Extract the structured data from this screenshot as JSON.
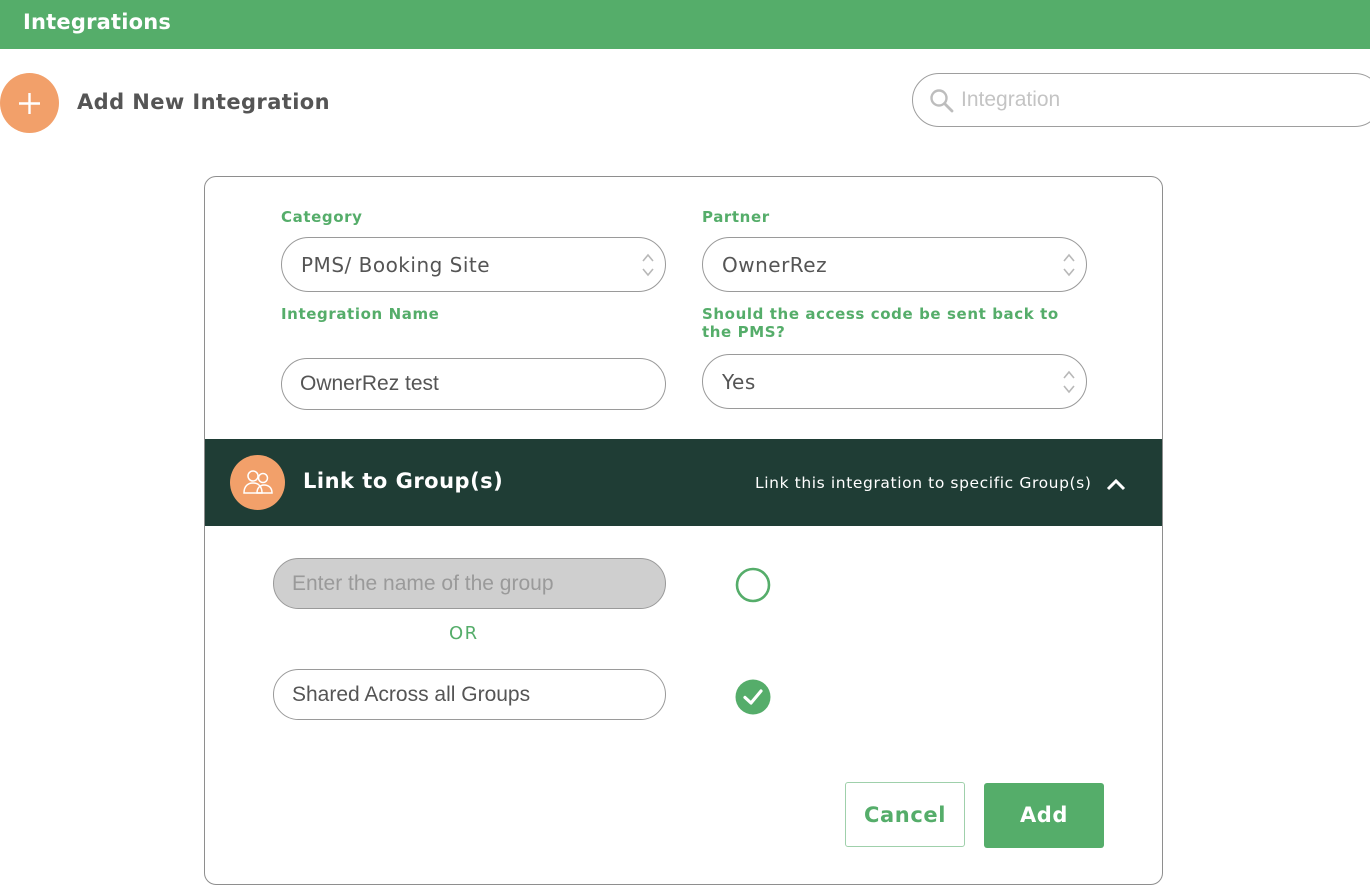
{
  "header": {
    "title": "Integrations"
  },
  "toolbar": {
    "add_label": "Add New Integration"
  },
  "search": {
    "placeholder": "Integration",
    "value": ""
  },
  "form": {
    "category": {
      "label": "Category",
      "value": "PMS/ Booking Site"
    },
    "partner": {
      "label": "Partner",
      "value": "OwnerRez"
    },
    "integration_name": {
      "label": "Integration Name",
      "value": "OwnerRez test"
    },
    "send_back": {
      "label": "Should the access code be sent back to the PMS?",
      "value": "Yes"
    }
  },
  "groups": {
    "title": "Link to Group(s)",
    "hint": "Link this integration to specific Group(s)",
    "expanded": true,
    "group_input_placeholder": "Enter the name of the group",
    "or_label": "OR",
    "shared_label": "Shared Across all Groups",
    "selected": "shared"
  },
  "actions": {
    "cancel": "Cancel",
    "add": "Add"
  },
  "colors": {
    "accent": "#55ad6a",
    "dark_band": "#1f3d35",
    "orange": "#f2a06a"
  }
}
